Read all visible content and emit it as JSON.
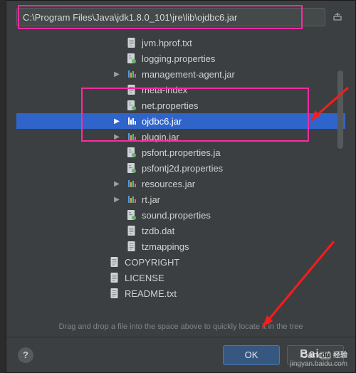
{
  "path": {
    "value": "C:\\Program Files\\Java\\jdk1.8.0_101\\jre\\lib\\ojdbc6.jar"
  },
  "tree": {
    "items": [
      {
        "kind": "txt",
        "label": "jvm.hprof.txt",
        "expandable": false,
        "selected": false
      },
      {
        "kind": "props",
        "label": "logging.properties",
        "expandable": false,
        "selected": false
      },
      {
        "kind": "jar",
        "label": "management-agent.jar",
        "expandable": true,
        "selected": false
      },
      {
        "kind": "txt",
        "label": "meta-index",
        "expandable": false,
        "selected": false
      },
      {
        "kind": "props",
        "label": "net.properties",
        "expandable": false,
        "selected": false
      },
      {
        "kind": "jar",
        "label": "ojdbc6.jar",
        "expandable": true,
        "selected": true
      },
      {
        "kind": "jar",
        "label": "plugin.jar",
        "expandable": true,
        "selected": false
      },
      {
        "kind": "props",
        "label": "psfont.properties.ja",
        "expandable": false,
        "selected": false
      },
      {
        "kind": "props",
        "label": "psfontj2d.properties",
        "expandable": false,
        "selected": false
      },
      {
        "kind": "jar",
        "label": "resources.jar",
        "expandable": true,
        "selected": false
      },
      {
        "kind": "jar",
        "label": "rt.jar",
        "expandable": true,
        "selected": false
      },
      {
        "kind": "props",
        "label": "sound.properties",
        "expandable": false,
        "selected": false
      },
      {
        "kind": "txt",
        "label": "tzdb.dat",
        "expandable": false,
        "selected": false
      },
      {
        "kind": "txt",
        "label": "tzmappings",
        "expandable": false,
        "selected": false
      },
      {
        "kind": "txt",
        "label": "COPYRIGHT",
        "expandable": false,
        "selected": false,
        "outdent": true
      },
      {
        "kind": "txt",
        "label": "LICENSE",
        "expandable": false,
        "selected": false,
        "outdent": true
      },
      {
        "kind": "txt",
        "label": "README.txt",
        "expandable": false,
        "selected": false,
        "outdent": true
      }
    ]
  },
  "hint": "Drag and drop a file into the space above to quickly locate it in the tree",
  "buttons": {
    "ok": "OK",
    "cancel": "Cancel",
    "help": "?"
  },
  "watermark": {
    "brand": "Bai",
    "brand2": "经验",
    "sub": "jingyan.baidu.com"
  },
  "colors": {
    "selection": "#2f65ca",
    "highlight": "#ff2aa0",
    "arrow": "#ff1a1a"
  }
}
